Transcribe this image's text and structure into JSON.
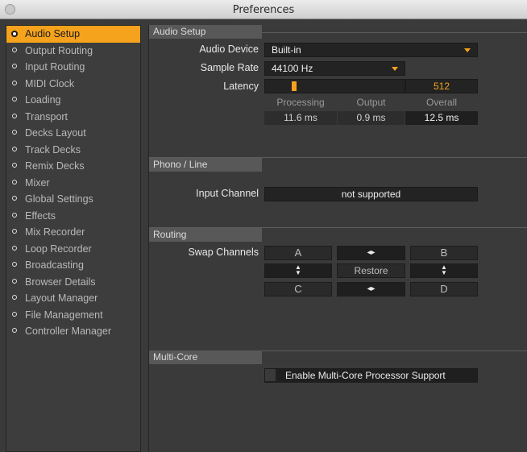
{
  "window": {
    "title": "Preferences"
  },
  "sidebar": {
    "items": [
      {
        "label": "Audio Setup",
        "active": true
      },
      {
        "label": "Output Routing"
      },
      {
        "label": "Input Routing"
      },
      {
        "label": "MIDI Clock"
      },
      {
        "label": "Loading"
      },
      {
        "label": "Transport"
      },
      {
        "label": "Decks Layout"
      },
      {
        "label": "Track Decks"
      },
      {
        "label": "Remix Decks"
      },
      {
        "label": "Mixer"
      },
      {
        "label": "Global Settings"
      },
      {
        "label": "Effects"
      },
      {
        "label": "Mix Recorder"
      },
      {
        "label": "Loop Recorder"
      },
      {
        "label": "Broadcasting"
      },
      {
        "label": "Browser Details"
      },
      {
        "label": "Layout Manager"
      },
      {
        "label": "File Management"
      },
      {
        "label": "Controller Manager"
      }
    ]
  },
  "audio_setup": {
    "header": "Audio Setup",
    "device_label": "Audio Device",
    "device_value": "Built-in",
    "sample_rate_label": "Sample Rate",
    "sample_rate_value": "44100 Hz",
    "latency_label": "Latency",
    "latency_value": "512",
    "latency_fraction": 0.2,
    "processing_label": "Processing",
    "output_label": "Output",
    "overall_label": "Overall",
    "processing_value": "11.6 ms",
    "output_value": "0.9 ms",
    "overall_value": "12.5 ms"
  },
  "phono": {
    "header": "Phono / Line",
    "input_label": "Input Channel",
    "input_value": "not supported"
  },
  "routing": {
    "header": "Routing",
    "swap_label": "Swap Channels",
    "a": "A",
    "b": "B",
    "c": "C",
    "d": "D",
    "restore": "Restore"
  },
  "multicore": {
    "header": "Multi-Core",
    "enable_label": "Enable Multi-Core Processor Support",
    "enabled": false
  },
  "colors": {
    "accent": "#f5a21d",
    "panel": "#3a3a3a",
    "field": "#232323"
  }
}
